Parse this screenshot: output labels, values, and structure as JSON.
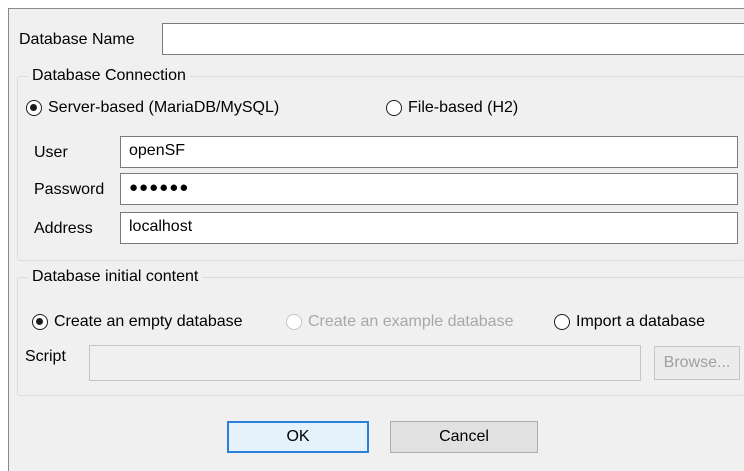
{
  "database_name": {
    "label": "Database Name",
    "value": ""
  },
  "connection": {
    "legend": "Database Connection",
    "options": [
      {
        "label": "Server-based (MariaDB/MySQL)",
        "selected": true
      },
      {
        "label": "File-based (H2)",
        "selected": false
      }
    ],
    "user": {
      "label": "User",
      "value": "openSF"
    },
    "password": {
      "label": "Password",
      "value": "●●●●●●"
    },
    "address": {
      "label": "Address",
      "value": "localhost"
    }
  },
  "initial_content": {
    "legend": "Database initial content",
    "options": [
      {
        "label": "Create an empty database",
        "selected": true,
        "enabled": true
      },
      {
        "label": "Create an example database",
        "selected": false,
        "enabled": false
      },
      {
        "label": "Import a database",
        "selected": false,
        "enabled": true
      }
    ],
    "script": {
      "label": "Script",
      "value": ""
    },
    "browse_label": "Browse..."
  },
  "buttons": {
    "ok": "OK",
    "cancel": "Cancel"
  },
  "colors": {
    "focus_blue": "#2b7fd6",
    "dialog_bg": "#f0f0f0"
  }
}
